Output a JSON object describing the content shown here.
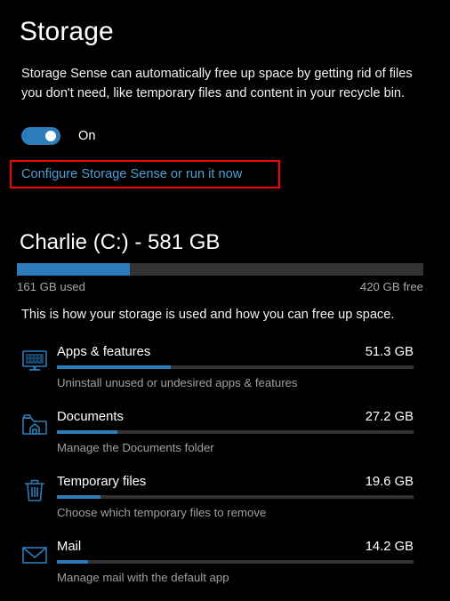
{
  "header": {
    "title": "Storage",
    "description": "Storage Sense can automatically free up space by getting rid of files you don't need, like temporary files and content in your recycle bin."
  },
  "storage_sense": {
    "toggle_state": "On",
    "toggle_on": true,
    "configure_link": "Configure Storage Sense or run it now",
    "highlight_color": "#ff0000"
  },
  "drive": {
    "title": "Charlie (C:) - 581 GB",
    "name": "Charlie",
    "letter": "C:",
    "capacity_gb": 581,
    "used_label": "161 GB used",
    "free_label": "420 GB free",
    "used_gb": 161,
    "free_gb": 420,
    "used_percent": 27.7,
    "subtitle": "This is how your storage is used and how you can free up space.",
    "bar_fill_color": "#2b7cb9",
    "bar_track_color": "#333333"
  },
  "categories": [
    {
      "icon": "monitor-apps-icon",
      "name": "Apps & features",
      "size": "51.3 GB",
      "size_gb": 51.3,
      "percent": 31.9,
      "description": "Uninstall unused or undesired apps & features"
    },
    {
      "icon": "documents-folder-icon",
      "name": "Documents",
      "size": "27.2 GB",
      "size_gb": 27.2,
      "percent": 16.9,
      "description": "Manage the Documents folder"
    },
    {
      "icon": "trash-icon",
      "name": "Temporary files",
      "size": "19.6 GB",
      "size_gb": 19.6,
      "percent": 12.2,
      "description": "Choose which temporary files to remove"
    },
    {
      "icon": "mail-envelope-icon",
      "name": "Mail",
      "size": "14.2 GB",
      "size_gb": 14.2,
      "percent": 8.8,
      "description": "Manage mail with the default app"
    }
  ],
  "colors": {
    "accent": "#2b7cb9",
    "background": "#000000",
    "text": "#ffffff",
    "muted_text": "#a0a0a0",
    "link": "#4f9fd4"
  }
}
